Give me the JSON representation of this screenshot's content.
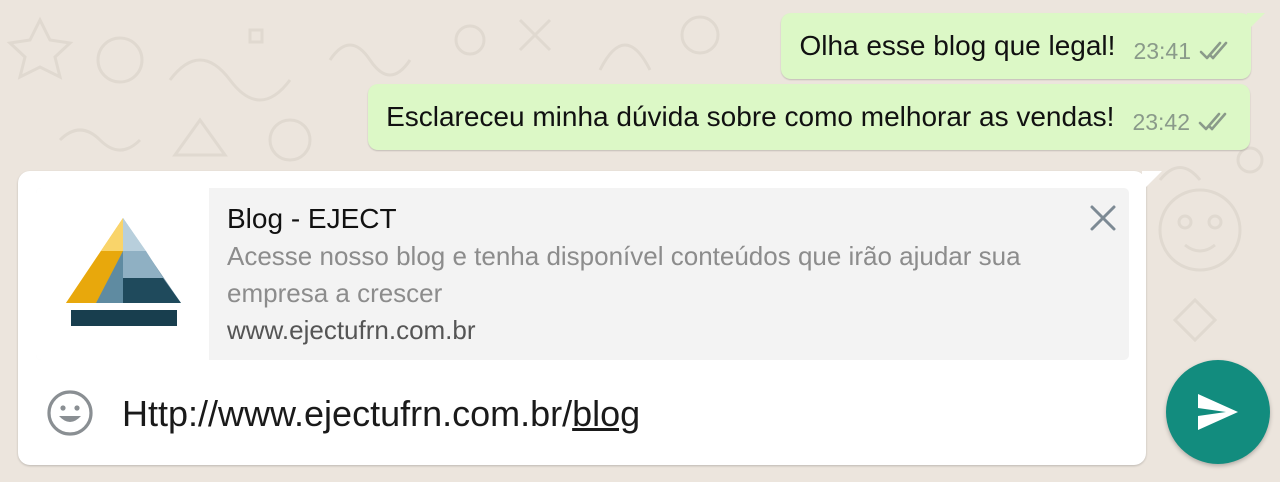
{
  "chat": {
    "messages": [
      {
        "text": "Olha esse blog que legal!",
        "time": "23:41",
        "status_icon": "double-check-icon"
      },
      {
        "text": "Esclareceu minha dúvida sobre como melhorar as vendas!",
        "time": "23:42",
        "status_icon": "double-check-icon"
      }
    ]
  },
  "link_preview": {
    "title": "Blog - EJECT",
    "description": "Acesse nosso blog e tenha disponível conteúdos que irão ajudar sua empresa a crescer",
    "url": "www.ejectufrn.com.br",
    "thumbnail_icon": "eject-logo-icon",
    "close_icon": "close-icon"
  },
  "composer": {
    "input_prefix": "Http://www.ejectufrn.com.br/",
    "input_underlined": "blog",
    "emoji_icon": "emoji-icon",
    "send_icon": "send-icon"
  },
  "colors": {
    "outgoing_bubble": "#dcf8c6",
    "send_button": "#128c7e",
    "background": "#ece5dd",
    "tick_color": "#8a9a8a"
  }
}
